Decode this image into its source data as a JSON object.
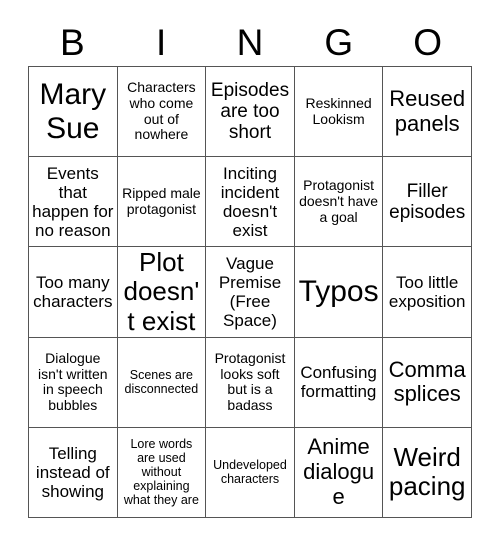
{
  "card": {
    "title": "BINGO",
    "header_letters": [
      "B",
      "I",
      "N",
      "G",
      "O"
    ],
    "grid_size": 5,
    "colors": {
      "background": "#ffffff",
      "text": "#000000",
      "grid_line": "#555555"
    },
    "free_space_cell_index": 12,
    "free_space_label": "(Free Space)"
  },
  "cells": [
    {
      "text": "Mary Sue",
      "size": "fs-hero"
    },
    {
      "text": "Characters who come out of nowhere",
      "size": "fs-sm"
    },
    {
      "text": "Episodes are too short",
      "size": "fs-l"
    },
    {
      "text": "Reskinned Lookism",
      "size": "fs-sm"
    },
    {
      "text": "Reused panels",
      "size": "fs-xl"
    },
    {
      "text": "Events that happen for no reason",
      "size": "fs-ml"
    },
    {
      "text": "Ripped male protagonist",
      "size": "fs-sm"
    },
    {
      "text": "Inciting incident doesn't exist",
      "size": "fs-ml"
    },
    {
      "text": "Protagonist doesn't have a goal",
      "size": "fs-sm"
    },
    {
      "text": "Filler episodes",
      "size": "fs-l"
    },
    {
      "text": "Too many characters",
      "size": "fs-ml"
    },
    {
      "text": "Plot doesn't exist",
      "size": "fs-xxl"
    },
    {
      "text": "Vague Premise (Free Space)",
      "size": "fs-ml"
    },
    {
      "text": "Typos",
      "size": "fs-hero"
    },
    {
      "text": "Too little exposition",
      "size": "fs-ml"
    },
    {
      "text": "Dialogue isn't written in speech bubbles",
      "size": "fs-sm"
    },
    {
      "text": "Scenes are disconnected",
      "size": "fs-s"
    },
    {
      "text": "Protagonist looks soft but is a badass",
      "size": "fs-sm"
    },
    {
      "text": "Confusing formatting",
      "size": "fs-ml"
    },
    {
      "text": "Comma splices",
      "size": "fs-xl"
    },
    {
      "text": "Telling instead of showing",
      "size": "fs-ml"
    },
    {
      "text": "Lore words are used without explaining what they are",
      "size": "fs-s"
    },
    {
      "text": "Undeveloped characters",
      "size": "fs-s"
    },
    {
      "text": "Anime dialogue",
      "size": "fs-xl"
    },
    {
      "text": "Weird pacing",
      "size": "fs-xxl"
    }
  ]
}
